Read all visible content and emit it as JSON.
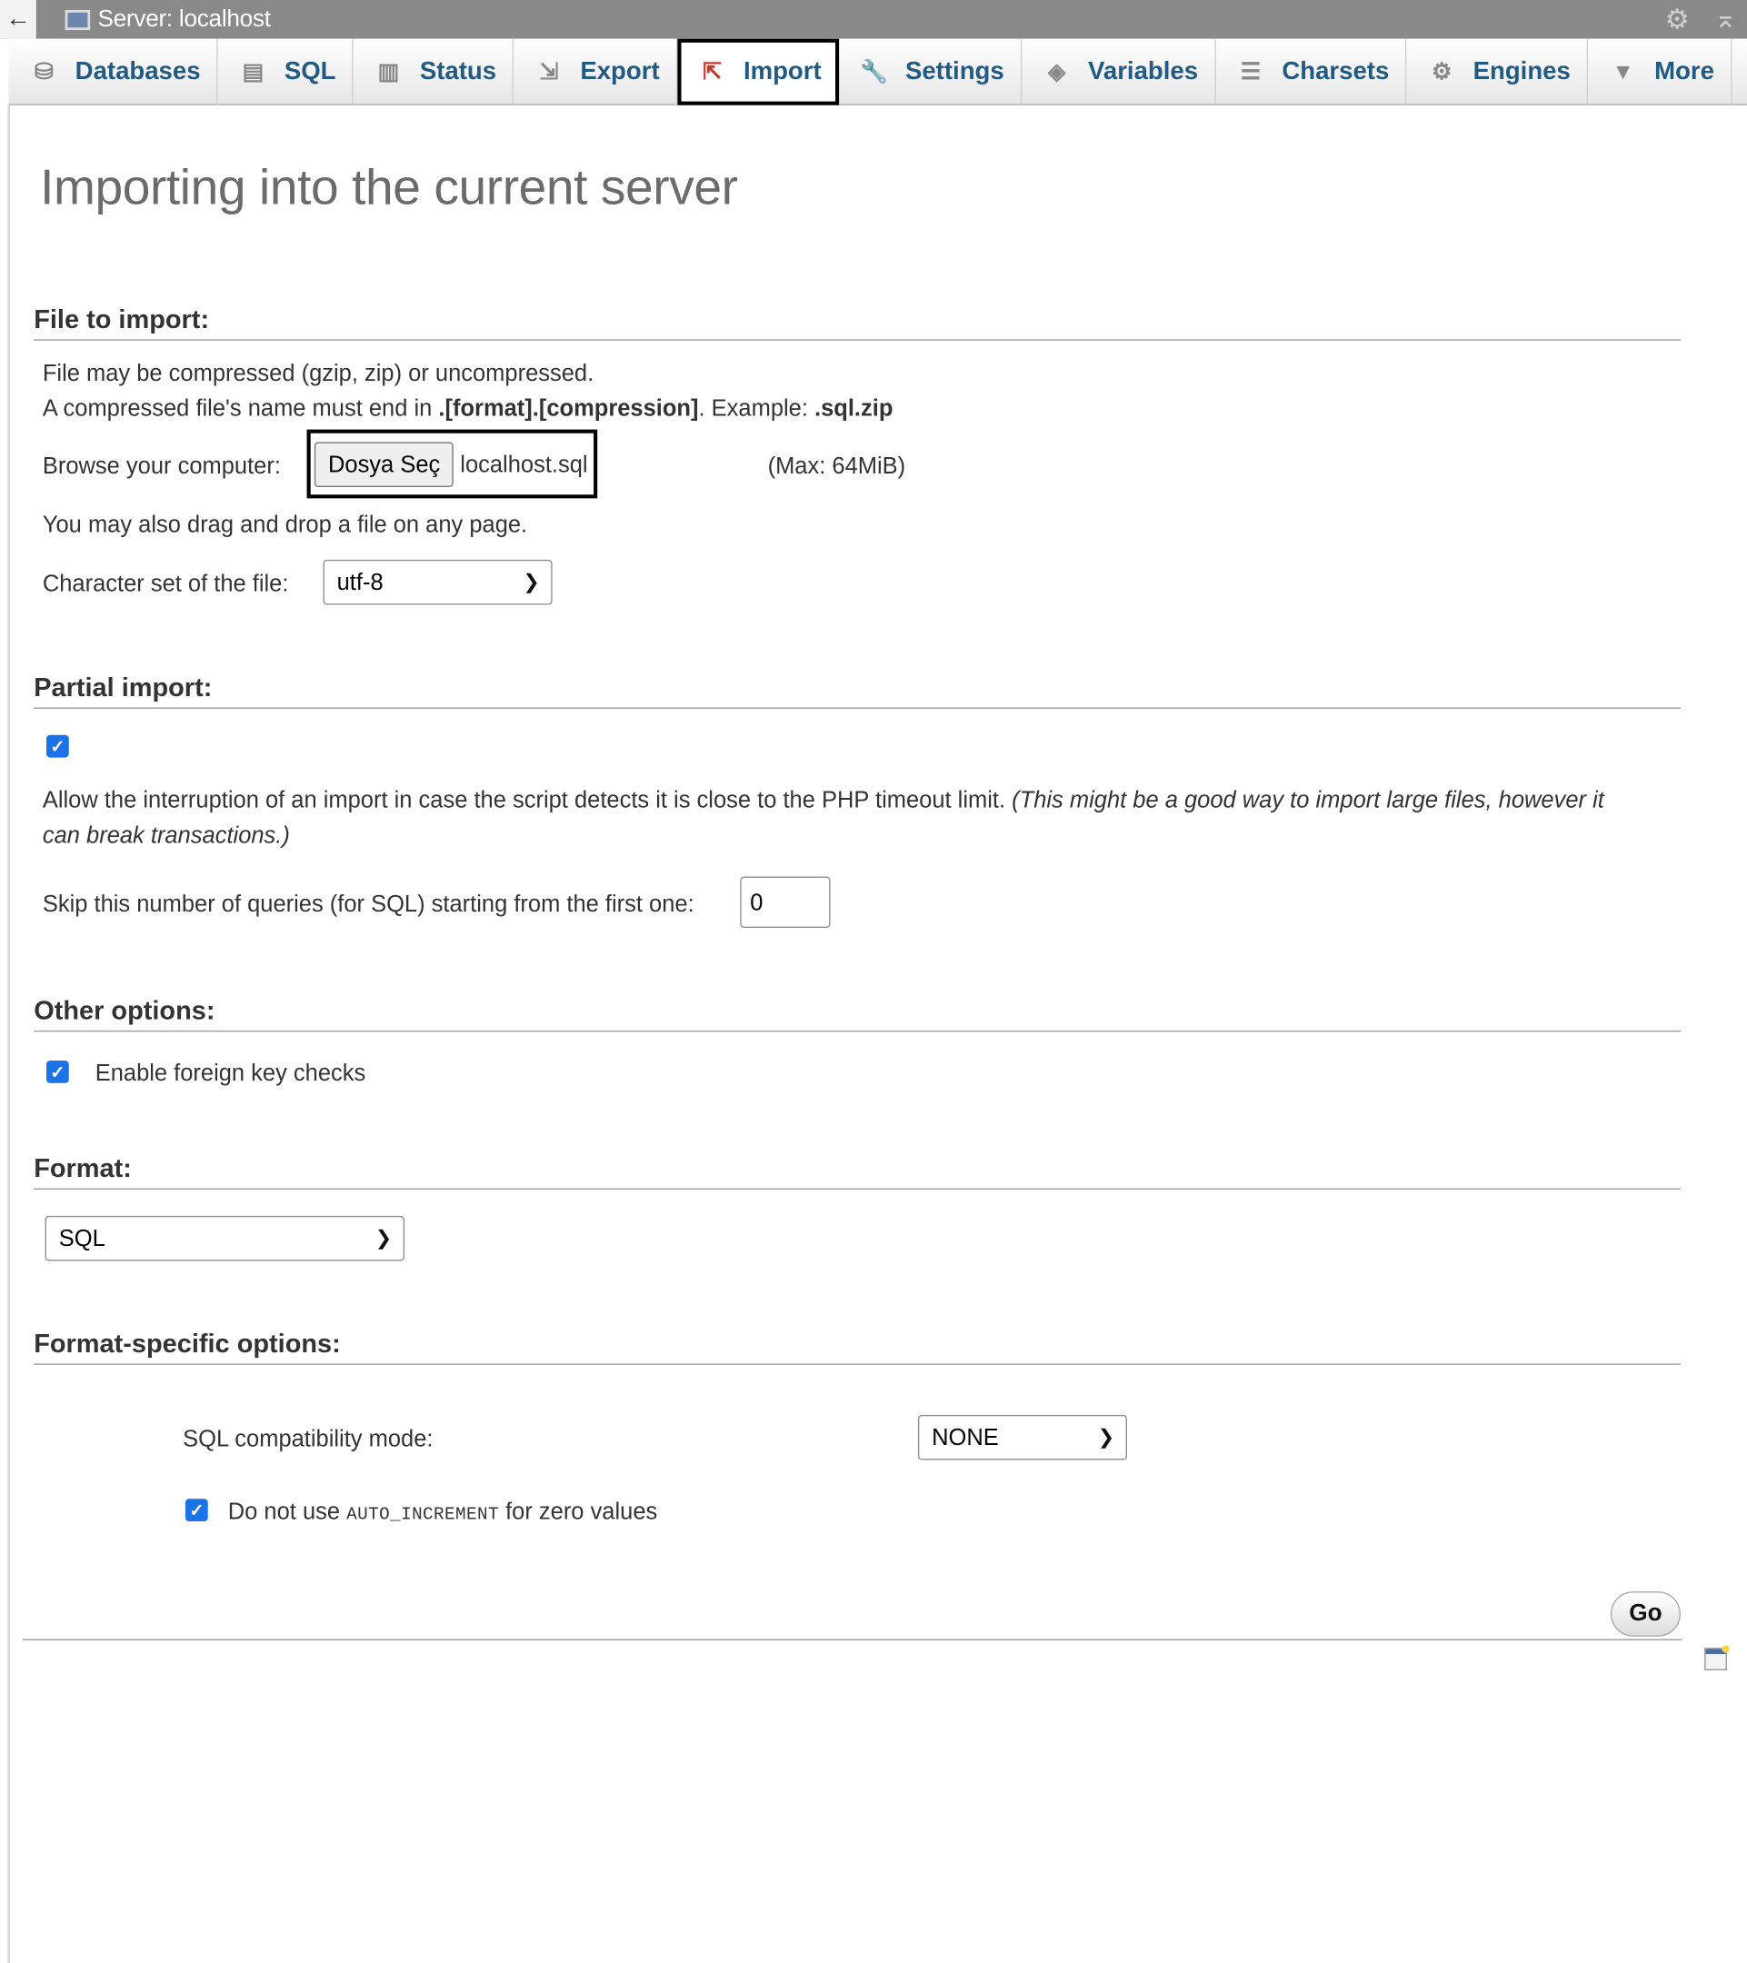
{
  "topbar": {
    "back": "←",
    "title": "Server: localhost"
  },
  "tabs": [
    {
      "label": "Databases",
      "icon": "database-icon",
      "glyph": "⛁"
    },
    {
      "label": "SQL",
      "icon": "sql-icon",
      "glyph": "▤"
    },
    {
      "label": "Status",
      "icon": "status-icon",
      "glyph": "▥"
    },
    {
      "label": "Export",
      "icon": "export-icon",
      "glyph": "⇲"
    },
    {
      "label": "Import",
      "icon": "import-icon",
      "glyph": "⇱"
    },
    {
      "label": "Settings",
      "icon": "wrench-icon",
      "glyph": "🔧"
    },
    {
      "label": "Variables",
      "icon": "variables-icon",
      "glyph": "◈"
    },
    {
      "label": "Charsets",
      "icon": "charsets-icon",
      "glyph": "☰"
    },
    {
      "label": "Engines",
      "icon": "engines-icon",
      "glyph": "⚙"
    },
    {
      "label": "More",
      "icon": "caret-down-icon",
      "glyph": "▼"
    }
  ],
  "page_title": "Importing into the current server",
  "file_section": {
    "heading": "File to import:",
    "line1": "File may be compressed (gzip, zip) or uncompressed.",
    "line2_pre": "A compressed file's name must end in ",
    "line2_bold": ".[format].[compression]",
    "line2_mid": ". Example: ",
    "line2_example": ".sql.zip",
    "browse_label": "Browse your computer:",
    "choose_button": "Dosya Seç",
    "file_name": "localhost.sql",
    "max_size": "(Max: 64MiB)",
    "drag_note": "You may also drag and drop a file on any page.",
    "charset_label": "Character set of the file:",
    "charset_value": "utf-8"
  },
  "partial_section": {
    "heading": "Partial import:",
    "allow_interrupt_checked": true,
    "allow_text": "Allow the interruption of an import in case the script detects it is close to the PHP timeout limit.",
    "allow_note_1": "(This might be a good way to import large files, however it",
    "allow_note_2": "can break transactions.)",
    "skip_label": "Skip this number of queries (for SQL) starting from the first one:",
    "skip_value": "0"
  },
  "other_section": {
    "heading": "Other options:",
    "fk_checked": true,
    "fk_label": "Enable foreign key checks"
  },
  "format_section": {
    "heading": "Format:",
    "value": "SQL"
  },
  "format_specific": {
    "heading": "Format-specific options:",
    "compat_label": "SQL compatibility mode:",
    "compat_value": "NONE",
    "auto_inc_checked": true,
    "auto_inc_pre": "Do not use ",
    "auto_inc_code": "AUTO_INCREMENT",
    "auto_inc_post": " for zero values"
  },
  "go_button": "Go"
}
